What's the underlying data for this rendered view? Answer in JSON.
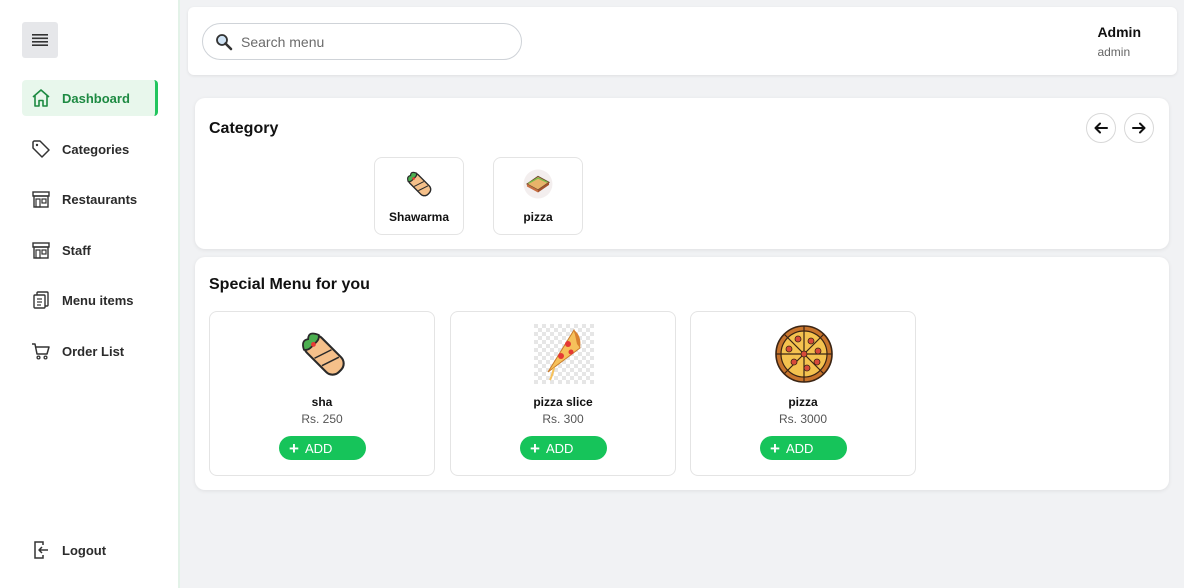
{
  "sidebar": {
    "items": [
      {
        "label": "Dashboard",
        "icon": "home-icon",
        "active": true
      },
      {
        "label": "Categories",
        "icon": "tag-icon"
      },
      {
        "label": "Restaurants",
        "icon": "store-icon"
      },
      {
        "label": "Staff",
        "icon": "store-icon"
      },
      {
        "label": "Menu items",
        "icon": "clipboard-icon"
      },
      {
        "label": "Order List",
        "icon": "cart-icon"
      }
    ],
    "logout_label": "Logout"
  },
  "header": {
    "search_placeholder": "Search menu",
    "user_name": "Admin",
    "user_role": "admin"
  },
  "category": {
    "title": "Category",
    "items": [
      {
        "label": "Shawarma",
        "icon": "shawarma-icon"
      },
      {
        "label": "pizza",
        "icon": "sandwich-icon"
      }
    ]
  },
  "special_menu": {
    "title": "Special Menu for you",
    "add_label": "ADD",
    "items": [
      {
        "name": "sha",
        "price": "Rs. 250",
        "icon": "shawarma-icon"
      },
      {
        "name": "pizza slice",
        "price": "Rs. 300",
        "icon": "pizza-slice-icon"
      },
      {
        "name": "pizza",
        "price": "Rs. 3000",
        "icon": "pizza-icon"
      }
    ]
  },
  "colors": {
    "accent": "#16c45a",
    "active_bg": "#e8f7ec",
    "active_text": "#1d8a42",
    "background": "#f1f2f4"
  }
}
